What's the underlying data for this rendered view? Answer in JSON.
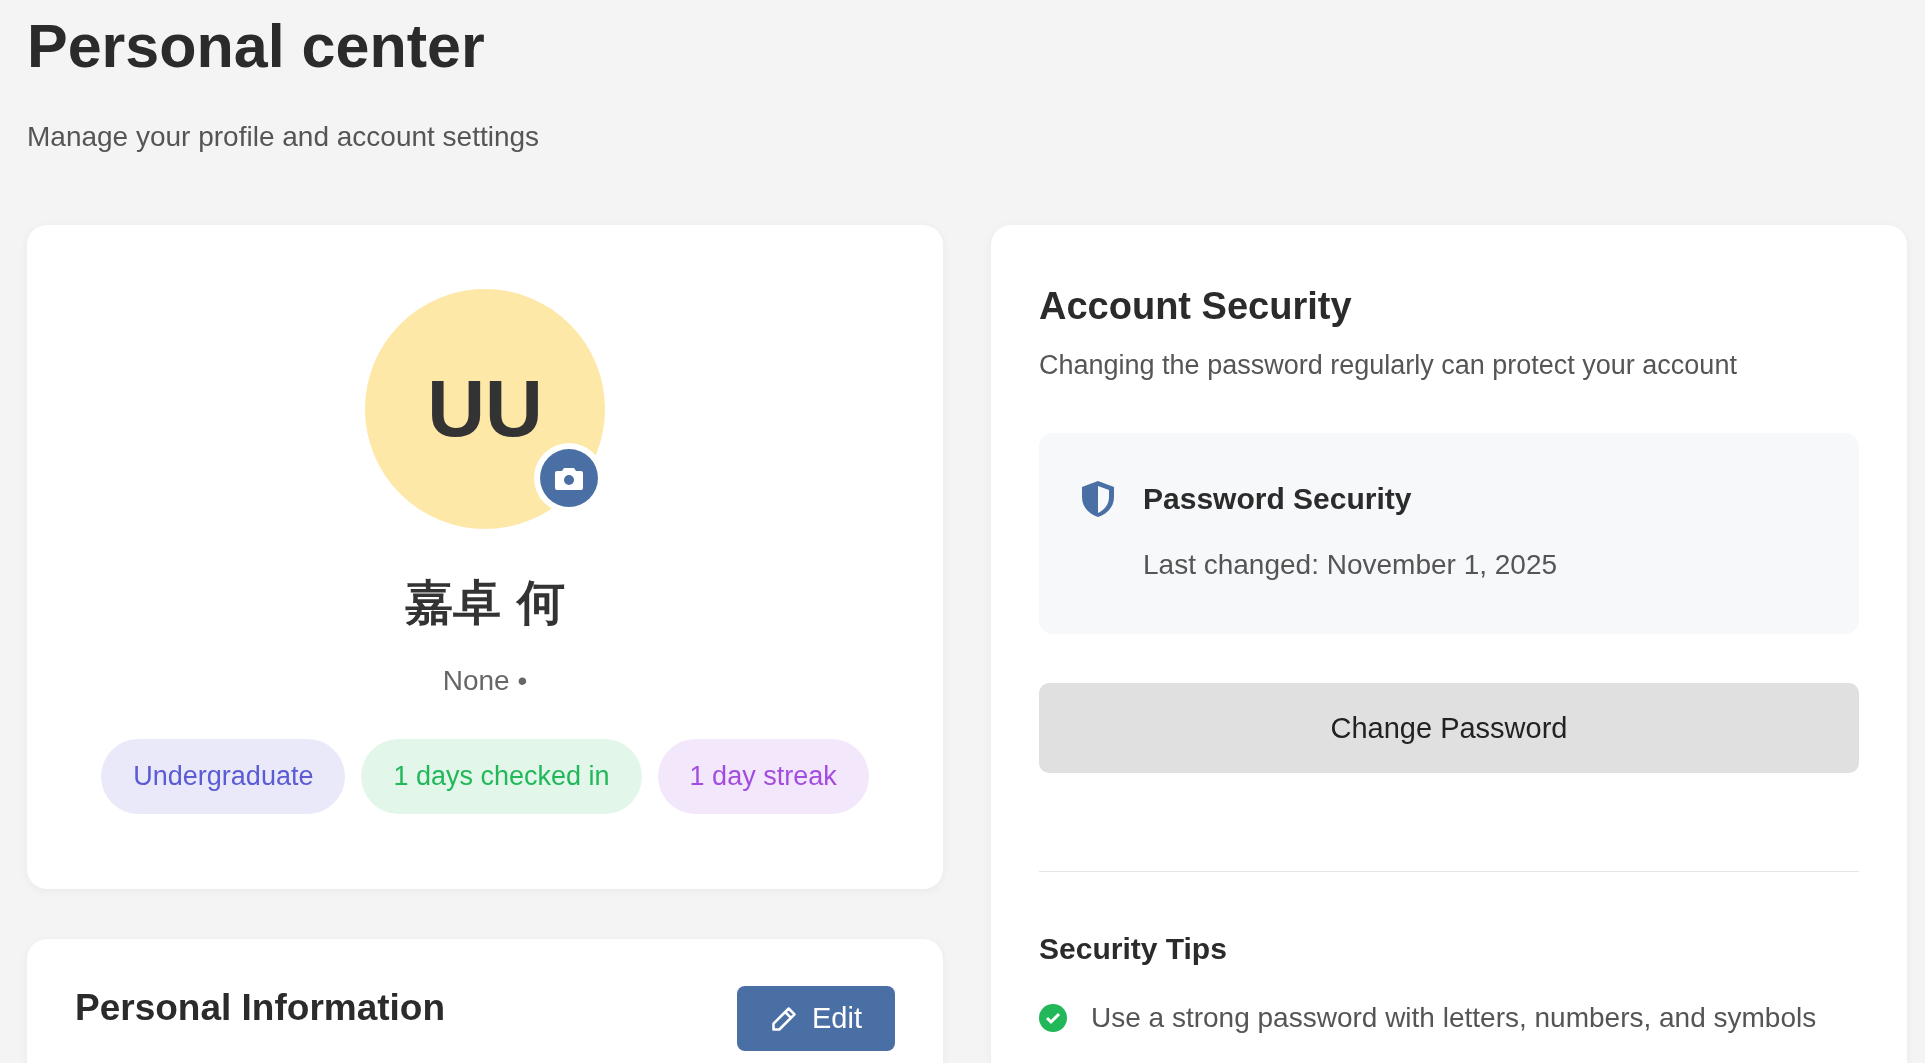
{
  "page": {
    "title": "Personal center",
    "subtitle": "Manage your profile and account settings"
  },
  "profile": {
    "initials": "UU",
    "name": "嘉卓 何",
    "meta": "None •",
    "badges": [
      {
        "label": "Undergraduate",
        "color": "#5b5bd6"
      },
      {
        "label": "1 days checked in",
        "color": "#22b85a"
      },
      {
        "label": "1 day streak",
        "color": "#a24de0"
      }
    ]
  },
  "personal_info": {
    "title": "Personal Information",
    "edit_button": "Edit"
  },
  "security": {
    "title": "Account Security",
    "description": "Changing the password regularly can protect your account",
    "password": {
      "title": "Password Security",
      "last_changed": "Last changed: November 1, 2025"
    },
    "change_button": "Change Password",
    "tips_title": "Security Tips",
    "tips": [
      {
        "text": "Use a strong password with letters, numbers, and symbols",
        "done": true
      }
    ]
  }
}
